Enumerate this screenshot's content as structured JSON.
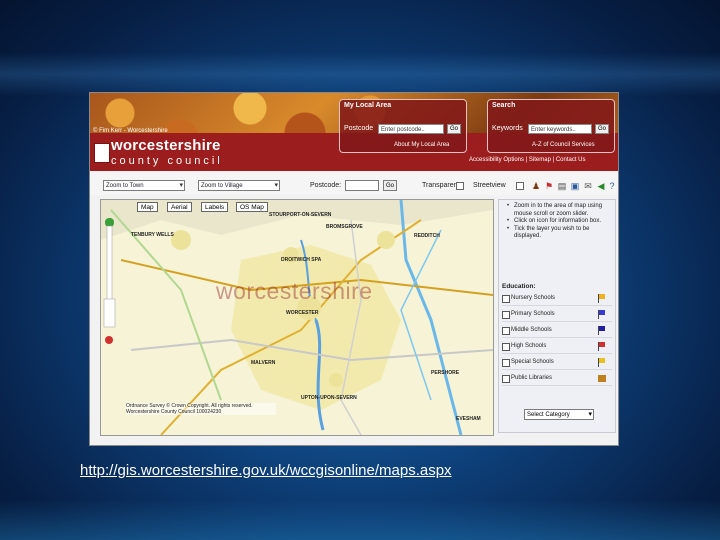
{
  "slide": {
    "url_caption": "http://gis.worcestershire.gov.uk/wccgisonline/maps.aspx"
  },
  "header": {
    "tagline": "© Fim Kerr - Worcestershire",
    "logo_line1": "worcestershire",
    "logo_line2": "county council",
    "local_area": {
      "title": "My Local Area",
      "postcode_label": "Postcode",
      "postcode_placeholder": "Enter postcode..",
      "go_label": "Go",
      "link": "About My Local Area"
    },
    "search": {
      "title": "Search",
      "keywords_label": "Keywords",
      "keywords_placeholder": "Enter keywords..",
      "go_label": "Go",
      "link": "A-Z of Council Services"
    },
    "access_links": "Accessibility Options | Sitemap | Contact Us"
  },
  "toolbar": {
    "town_select": "Zoom to Town",
    "village_select": "Zoom to Village",
    "postcode_label": "Postcode:",
    "go_label": "Go",
    "transparent_label": "Transparent",
    "streetview_label": "Streetview"
  },
  "map": {
    "tabs": [
      "Map",
      "Aerial",
      "Labels",
      "OS Map"
    ],
    "watermark": "worcestershire",
    "places": [
      "STOURPORT-ON-SEVERN",
      "BROMSGROVE",
      "REDDITCH",
      "DROITWICH SPA",
      "WORCESTER",
      "PERSHORE",
      "EVESHAM",
      "MALVERN",
      "TENBURY WELLS",
      "UPTON-UPON-SEVERN"
    ],
    "copyright": "Ordnance Survey © Crown Copyright. All rights reserved. Worcestershire County Council 100024230"
  },
  "sidebar": {
    "instructions": [
      "Zoom in to the area of map using mouse scroll or zoom slider.",
      "Click on icon for information box.",
      "Tick the layer you wish to be displayed."
    ],
    "section_title": "Education:",
    "layers": [
      {
        "label": "Nursery Schools",
        "color": "#f0b020"
      },
      {
        "label": "Primary Schools",
        "color": "#3a3ad0"
      },
      {
        "label": "Middle Schools",
        "color": "#2020a0"
      },
      {
        "label": "High Schools",
        "color": "#d03030"
      },
      {
        "label": "Special Schools",
        "color": "#e8c020"
      },
      {
        "label": "Public Libraries",
        "color": "#c08020"
      }
    ],
    "category_select": "Select Category"
  }
}
